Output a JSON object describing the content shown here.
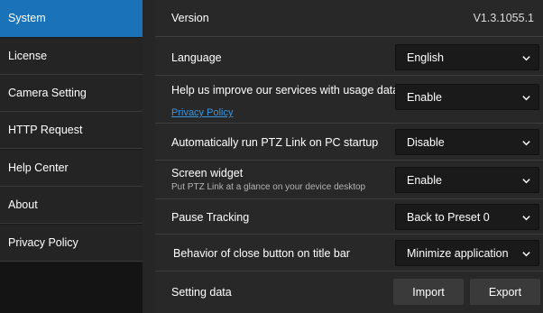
{
  "sidebar": {
    "items": [
      {
        "label": "System",
        "active": true
      },
      {
        "label": "License"
      },
      {
        "label": "Camera Setting"
      },
      {
        "label": "HTTP Request"
      },
      {
        "label": "Help Center"
      },
      {
        "label": "About"
      },
      {
        "label": "Privacy Policy"
      }
    ]
  },
  "settings": {
    "version": {
      "label": "Version",
      "value": "V1.3.1055.1"
    },
    "language": {
      "label": "Language",
      "value": "English"
    },
    "usage_data": {
      "label": "Help us improve our services with usage data",
      "link": "Privacy Policy",
      "value": "Enable"
    },
    "auto_run": {
      "label": "Automatically run PTZ Link on PC startup",
      "value": "Disable"
    },
    "screen_widget": {
      "label": "Screen widget",
      "description": "Put PTZ Link at a glance on your device desktop",
      "value": "Enable"
    },
    "pause_tracking": {
      "label": "Pause Tracking",
      "value": "Back to Preset 0"
    },
    "close_behavior": {
      "label": "Behavior of close button on title bar",
      "value": "Minimize application"
    },
    "setting_data": {
      "label": "Setting data",
      "import_label": "Import",
      "export_label": "Export"
    }
  },
  "colors": {
    "accent": "#1a73b8",
    "link": "#3b95e0",
    "background": "#282828",
    "sidebar_bg": "#242424"
  },
  "icons": {
    "dropdown": "chevron-down-icon"
  }
}
